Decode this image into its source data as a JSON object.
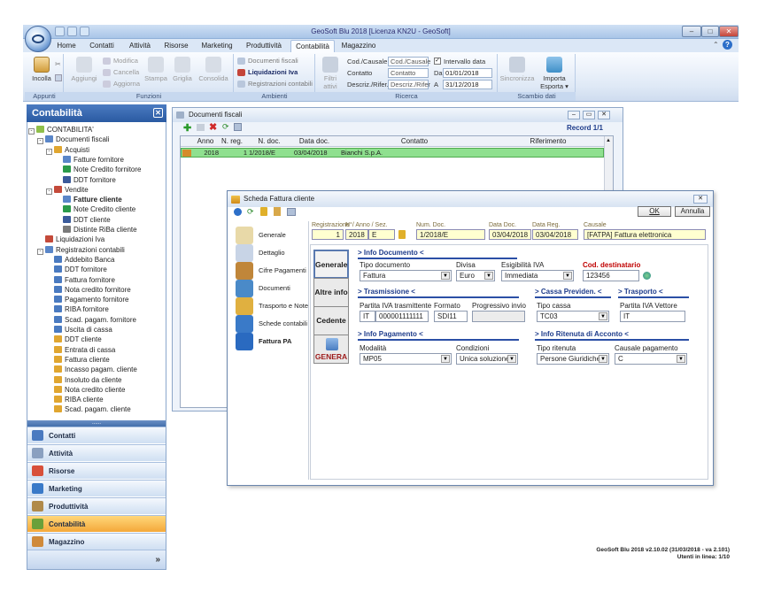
{
  "window": {
    "title": "GeoSoft Blu 2018 [Licenza KN2U - GeoSoft]"
  },
  "ribbon_tabs": [
    "Home",
    "Contatti",
    "Attività",
    "Risorse",
    "Marketing",
    "Produttività",
    "Contabilità",
    "Magazzino"
  ],
  "ribbon": {
    "appunti": {
      "incolla": "Incolla",
      "group": "Appunti"
    },
    "funzioni": {
      "aggiungi": "Aggiungi",
      "modifica": "Modifica",
      "cancella": "Cancella",
      "aggiorna": "Aggiorna",
      "stampa": "Stampa",
      "griglia": "Griglia",
      "consolida": "Consolida",
      "group": "Funzioni"
    },
    "ambienti": {
      "documenti_fiscali": "Documenti fiscali",
      "liquidazioni_iva": "Liquidazioni Iva",
      "registrazioni_contabili": "Registrazioni contabili",
      "group": "Ambienti"
    },
    "ricerca": {
      "filtri": "Filtri attivi",
      "cod_causale_label": "Cod./Causale",
      "cod_causale_placeholder": "Cod./Causale",
      "contatto_label": "Contatto",
      "contatto_placeholder": "Contatto",
      "descriz_label": "Descriz./Rifer.",
      "descriz_placeholder": "Descriz./Rifer",
      "intervallo": "Intervallo data",
      "da_label": "Da",
      "da_value": "01/01/2018",
      "a_label": "A",
      "a_value": "31/12/2018",
      "group": "Ricerca"
    },
    "scambio": {
      "sincronizza": "Sincronizza",
      "importa": "Importa",
      "esporta": "Esporta",
      "group": "Scambio dati"
    }
  },
  "left_panel": {
    "title": "Contabilità",
    "tree": [
      {
        "label": "CONTABILITA'",
        "level": 0,
        "icon": "folder",
        "expander": "-"
      },
      {
        "label": "Documenti fiscali",
        "level": 1,
        "icon": "docs",
        "expander": "-"
      },
      {
        "label": "Acquisti",
        "level": 2,
        "icon": "basket",
        "expander": "-"
      },
      {
        "label": "Fatture fornitore",
        "level": 3,
        "icon": "invoice"
      },
      {
        "label": "Note Credito fornitore",
        "level": 3,
        "icon": "note"
      },
      {
        "label": "DDT fornitore",
        "level": 3,
        "icon": "ddt"
      },
      {
        "label": "Vendite",
        "level": 2,
        "icon": "sales",
        "expander": "-"
      },
      {
        "label": "Fatture cliente",
        "level": 3,
        "icon": "invoice",
        "bold": true
      },
      {
        "label": "Note Credito cliente",
        "level": 3,
        "icon": "note"
      },
      {
        "label": "DDT cliente",
        "level": 3,
        "icon": "ddt"
      },
      {
        "label": "Distinte RiBa cliente",
        "level": 3,
        "icon": "riba"
      },
      {
        "label": "Liquidazioni Iva",
        "level": 1,
        "icon": "tax"
      },
      {
        "label": "Registrazioni contabili",
        "level": 1,
        "icon": "ledger",
        "expander": "-"
      },
      {
        "label": "Addebito Banca",
        "level": 2,
        "icon": "entry"
      },
      {
        "label": "DDT fornitore",
        "level": 2,
        "icon": "entry"
      },
      {
        "label": "Fattura fornitore",
        "level": 2,
        "icon": "entry"
      },
      {
        "label": "Nota credito fornitore",
        "level": 2,
        "icon": "entry"
      },
      {
        "label": "Pagamento fornitore",
        "level": 2,
        "icon": "entry"
      },
      {
        "label": "RIBA fornitore",
        "level": 2,
        "icon": "entry"
      },
      {
        "label": "Scad. pagam. fornitore",
        "level": 2,
        "icon": "entry"
      },
      {
        "label": "Uscita di cassa",
        "level": 2,
        "icon": "entry"
      },
      {
        "label": "DDT cliente",
        "level": 2,
        "icon": "entry2"
      },
      {
        "label": "Entrata di cassa",
        "level": 2,
        "icon": "entry2"
      },
      {
        "label": "Fattura cliente",
        "level": 2,
        "icon": "entry2"
      },
      {
        "label": "Incasso pagam. cliente",
        "level": 2,
        "icon": "entry2"
      },
      {
        "label": "Insoluto da cliente",
        "level": 2,
        "icon": "entry2"
      },
      {
        "label": "Nota credito cliente",
        "level": 2,
        "icon": "entry2"
      },
      {
        "label": "RIBA cliente",
        "level": 2,
        "icon": "entry2"
      },
      {
        "label": "Scad. pagam. cliente",
        "level": 2,
        "icon": "entry2"
      }
    ],
    "nav": [
      "Contatti",
      "Attività",
      "Risorse",
      "Marketing",
      "Produttività",
      "Contabilità",
      "Magazzino"
    ],
    "nav_active": "Contabilità",
    "nav_more": "»"
  },
  "documents_window": {
    "title": "Documenti fiscali",
    "record_info": "Record 1/1",
    "columns": [
      "Anno",
      "N. reg.",
      "N. doc.",
      "Data doc.",
      "Contatto",
      "Riferimento"
    ],
    "rows": [
      {
        "anno": "2018",
        "nreg": "1",
        "ndoc": "1/2018/E",
        "data": "03/04/2018",
        "contatto": "Bianchi S.p.A.",
        "rif": ""
      }
    ]
  },
  "dialog": {
    "title": "Scheda Fattura cliente",
    "ok": "OK",
    "annulla": "Annulla",
    "left_nav": [
      "Generale",
      "Dettaglio",
      "Cifre Pagamenti",
      "Documenti",
      "Trasporto e Note",
      "Schede contabili",
      "Fattura PA"
    ],
    "left_nav_active": "Fattura PA",
    "header_fields": {
      "registrazione_label": "Registrazione",
      "nanno_label": "N°/ Anno / Sez.",
      "registrazione": "1",
      "anno": "2018",
      "sez": "E",
      "numdoc_label": "Num. Doc.",
      "numdoc": "1/2018/E",
      "datadoc_label": "Data Doc.",
      "datadoc": "03/04/2018",
      "datareg_label": "Data Reg.",
      "datareg": "03/04/2018",
      "causale_label": "Causale",
      "causale": "[FATPA] Fattura elettronica"
    },
    "side_buttons": [
      "Generale",
      "Altre info",
      "Cedente",
      "GENERA"
    ],
    "info_documento": {
      "title": "> Info Documento <",
      "tipo_label": "Tipo documento",
      "tipo": "Fattura",
      "divisa_label": "Divisa",
      "divisa": "Euro",
      "esig_label": "Esigibilità IVA",
      "esig": "Immediata",
      "cod_label": "Cod. destinatario",
      "cod": "123456"
    },
    "trasmissione": {
      "title": "> Trasmissione <",
      "piva_label": "Partita IVA trasmittente",
      "piva_country": "IT",
      "piva": "000001111111",
      "formato_label": "Formato",
      "formato": "SDI11",
      "progr_label": "Progressivo invio",
      "progr": ""
    },
    "cassa": {
      "title": "> Cassa Previden. <",
      "tipo_label": "Tipo cassa",
      "tipo": "TC03"
    },
    "trasporto": {
      "title": "> Trasporto <",
      "piva_label": "Partita IVA Vettore",
      "piva": "IT"
    },
    "pagamento": {
      "title": "> Info Pagamento <",
      "modalita_label": "Modalità",
      "modalita": "MP05",
      "condizioni_label": "Condizioni",
      "condizioni": "Unica soluzione"
    },
    "ritenuta": {
      "title": "> Info Ritenuta di Acconto <",
      "tipo_label": "Tipo ritenuta",
      "tipo": "Persone Giuridiche",
      "causale_label": "Causale pagamento",
      "causale": "C"
    }
  },
  "status": {
    "version": "GeoSoft Blu 2018  v2.10.02 (31/03/2018 - va 2.101)",
    "utenti": "Utenti in linea: 1/10"
  }
}
